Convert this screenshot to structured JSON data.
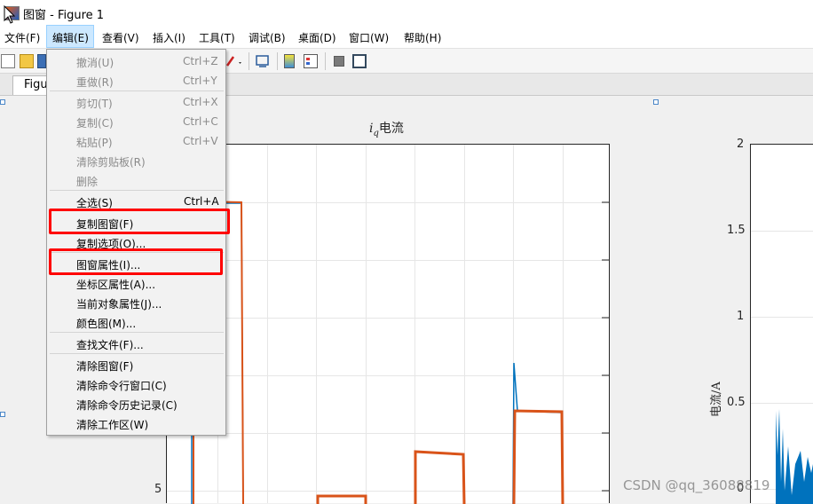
{
  "window": {
    "title": "图窗 - Figure 1"
  },
  "menubar": {
    "items": [
      "文件(F)",
      "编辑(E)",
      "查看(V)",
      "插入(I)",
      "工具(T)",
      "调试(B)",
      "桌面(D)",
      "窗口(W)",
      "帮助(H)"
    ],
    "active": "编辑(E)"
  },
  "tabs": {
    "figure_label": "Figu"
  },
  "edit_menu": {
    "undo": {
      "label": "撤消(U)",
      "shortcut": "Ctrl+Z",
      "enabled": false
    },
    "redo": {
      "label": "重做(R)",
      "shortcut": "Ctrl+Y",
      "enabled": false
    },
    "cut": {
      "label": "剪切(T)",
      "shortcut": "Ctrl+X",
      "enabled": false
    },
    "copy": {
      "label": "复制(C)",
      "shortcut": "Ctrl+C",
      "enabled": false
    },
    "paste": {
      "label": "粘贴(P)",
      "shortcut": "Ctrl+V",
      "enabled": false
    },
    "clear_clipboard": {
      "label": "清除剪贴板(R)",
      "enabled": false
    },
    "delete": {
      "label": "删除",
      "enabled": false
    },
    "select_all": {
      "label": "全选(S)",
      "shortcut": "Ctrl+A",
      "enabled": true
    },
    "copy_figure": {
      "label": "复制图窗(F)",
      "enabled": true,
      "highlighted": true
    },
    "copy_options": {
      "label": "复制选项(O)...",
      "enabled": true
    },
    "figure_properties": {
      "label": "图窗属性(I)...",
      "enabled": true,
      "highlighted": true
    },
    "axes_properties": {
      "label": "坐标区属性(A)...",
      "enabled": true
    },
    "current_object_properties": {
      "label": "当前对象属性(J)...",
      "enabled": true
    },
    "colormap": {
      "label": "颜色图(M)...",
      "enabled": true
    },
    "find_files": {
      "label": "查找文件(F)...",
      "enabled": true
    },
    "clear_figure": {
      "label": "清除图窗(F)",
      "enabled": true
    },
    "clear_command_window": {
      "label": "清除命令行窗口(C)",
      "enabled": true
    },
    "clear_command_history": {
      "label": "清除命令历史记录(C)",
      "enabled": true
    },
    "clear_workspace": {
      "label": "清除工作区(W)",
      "enabled": true
    }
  },
  "figure": {
    "axes1": {
      "title_symbol": "i",
      "title_subscript": "q",
      "title_text": "电流",
      "ytick_labels": [
        "5"
      ]
    },
    "axes2": {
      "ylabel": "电流/A",
      "ytick_labels": [
        "2",
        "1.5",
        "1",
        "0.5",
        "0"
      ]
    }
  },
  "colors": {
    "series_orange": "#d95319",
    "series_blue": "#0072bd",
    "highlight_box": "#ff0000",
    "menu_active": "#cce8ff"
  },
  "watermark": "CSDN @qq_36088819"
}
